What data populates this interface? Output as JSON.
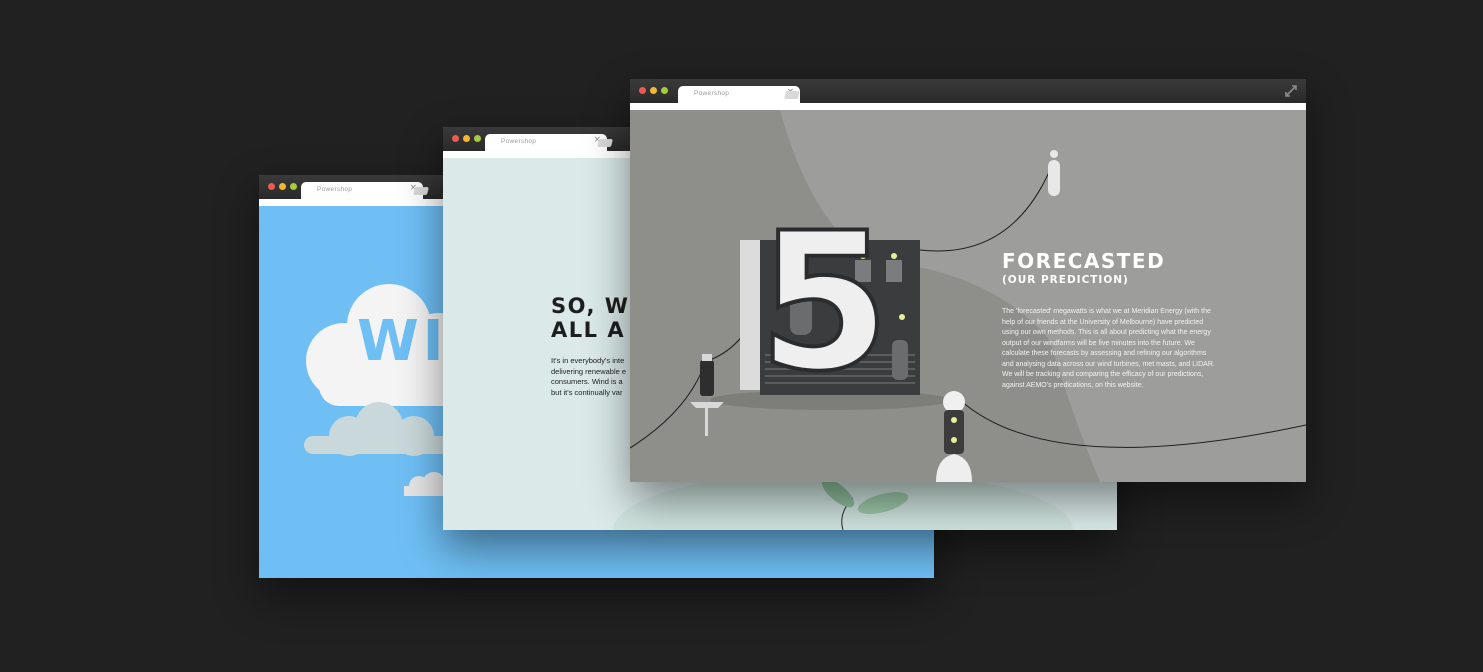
{
  "colors": {
    "background": "#212121",
    "dot_red": "#ef5b4f",
    "dot_yellow": "#f5b633",
    "dot_green": "#a6cc3b",
    "sky_blue": "#6fbff5",
    "mint": "#dbe9e9",
    "forecast_grey": "#8e8e8b"
  },
  "windows": [
    {
      "tab_title": "Powershop",
      "close_glyph": "×",
      "hero_text": "WI"
    },
    {
      "tab_title": "Powershop",
      "close_glyph": "×",
      "heading_line1": "SO, W",
      "heading_line2": "ALL A",
      "body_lines": [
        "It's in everybody's inte",
        "delivering renewable e",
        "consumers. Wind is a",
        "but it's continually var"
      ]
    },
    {
      "tab_title": "Powershop",
      "close_glyph": "×",
      "expand_icon": "expand-icon",
      "big_number": "5",
      "heading": "FORECASTED",
      "subheading": "(OUR PREDICTION)",
      "body_lines": [
        "The 'forecasted' megawatts is what we at Meridian Energy (with the",
        "help of our friends at the University of Melbourne) have predicted",
        "using our own methods. This is all about predicting what the energy",
        "output of our windfarms will be five minutes into the future. We",
        "calculate these forecasts by assessing and refining our algorithms",
        "and analysing data across our wind turbines, met masts, and LIDAR.",
        "We will be tracking and comparing the efficacy of our predictions,",
        "against AEMO's predications, on this website."
      ]
    }
  ]
}
